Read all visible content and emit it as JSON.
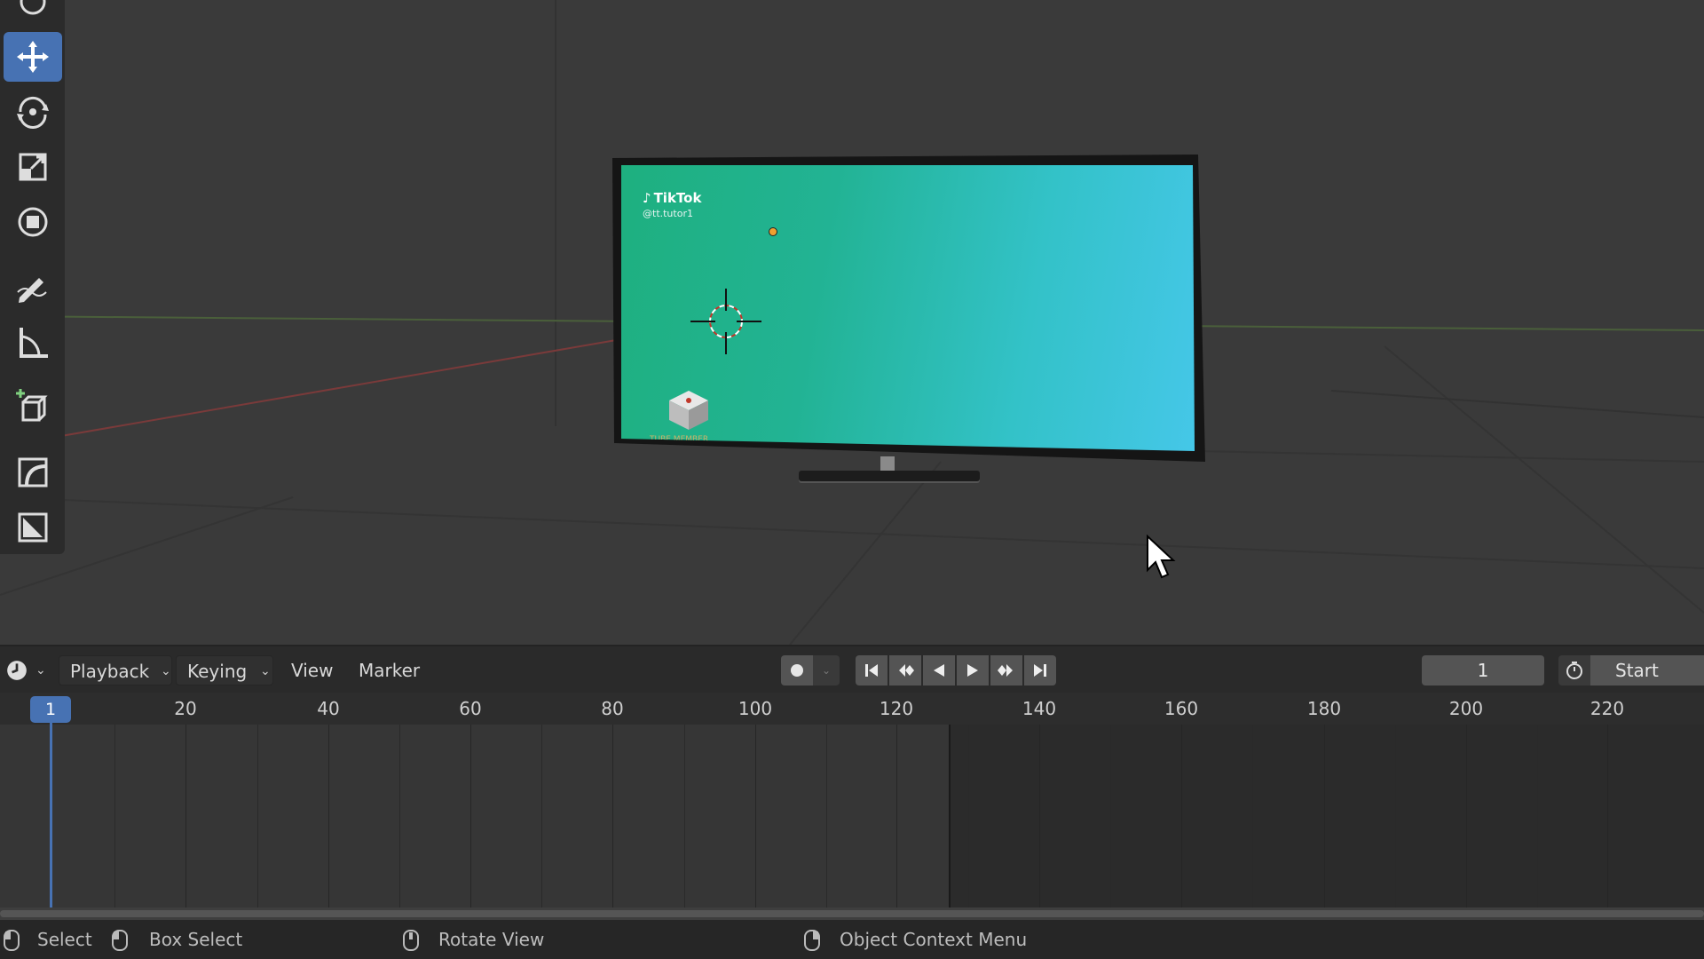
{
  "viewport": {
    "tv_screen": {
      "logo": "TikTok",
      "handle": "@tt.tutor1",
      "cube_caption": "TUBE MEMBER"
    }
  },
  "toolbar": {
    "tools": [
      "move-icon",
      "rotate-icon",
      "scale-icon",
      "transform-icon",
      "annotate-icon",
      "measure-icon",
      "add-cube-icon",
      "shear-icon",
      "crop-icon"
    ],
    "active": "move-icon"
  },
  "timeline": {
    "editor_type_icon": "clock-icon",
    "menus": {
      "playback": "Playback",
      "keying": "Keying",
      "view": "View",
      "marker": "Marker"
    },
    "current_frame": "1",
    "start_label": "Start",
    "ruler_ticks": [
      "20",
      "40",
      "60",
      "80",
      "100",
      "120",
      "140",
      "160",
      "180",
      "200",
      "220"
    ],
    "playhead_label": "1"
  },
  "statusbar": {
    "select": "Select",
    "box_select": "Box Select",
    "rotate_view": "Rotate View",
    "context_menu": "Object Context Menu"
  },
  "colors": {
    "accent": "#4772b3",
    "viewport_bg": "#3a3a3a",
    "screen_start": "#1eb07f",
    "screen_end": "#45c7e8"
  }
}
